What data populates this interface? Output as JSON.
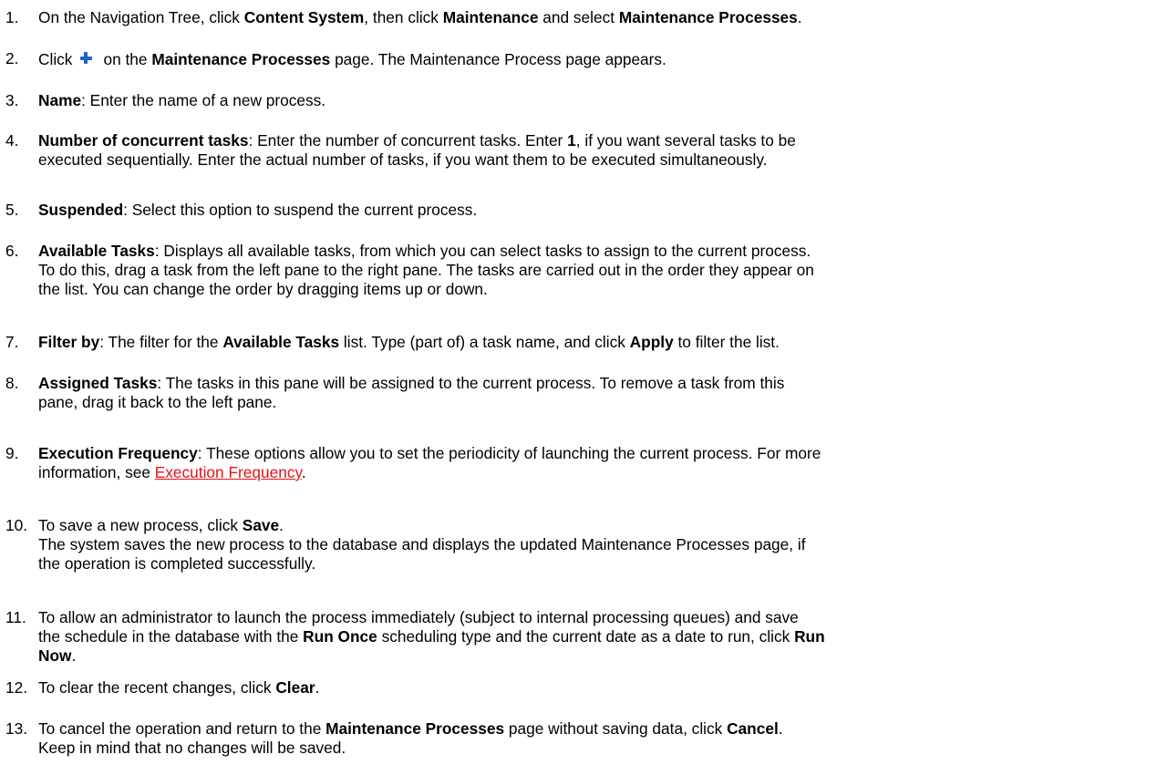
{
  "steps": [
    {
      "num": "1.",
      "parts": [
        {
          "t": "On the Navigation Tree, click "
        },
        {
          "t": "Content System",
          "b": true
        },
        {
          "t": ", then click "
        },
        {
          "t": "Maintenance",
          "b": true
        },
        {
          "t": " and select "
        },
        {
          "t": "Maintenance Processes",
          "b": true
        },
        {
          "t": "."
        }
      ]
    },
    {
      "num": "2.",
      "parts": [
        {
          "t": "Click"
        },
        {
          "icon": "plus-icon"
        },
        {
          "t": "on the "
        },
        {
          "t": "Maintenance Processes",
          "b": true
        },
        {
          "t": " page. The Maintenance Process page appears."
        }
      ]
    },
    {
      "num": "3.",
      "parts": [
        {
          "t": "Name",
          "b": true
        },
        {
          "t": ": Enter the name of a new process."
        }
      ]
    },
    {
      "num": "4.",
      "parts": [
        {
          "t": "Number of concurrent tasks",
          "b": true
        },
        {
          "t": ": Enter the number of concurrent tasks. Enter "
        },
        {
          "t": "1",
          "b": true
        },
        {
          "t": ", if you want several tasks to be"
        },
        {
          "br": true
        },
        {
          "t": "executed sequentially. Enter the actual number of tasks, if you want them to be executed simultaneously."
        }
      ]
    },
    {
      "num": "5.",
      "parts": [
        {
          "t": "Suspended",
          "b": true
        },
        {
          "t": ": Select this option to suspend the current process."
        }
      ]
    },
    {
      "num": "6.",
      "parts": [
        {
          "t": "Available Tasks",
          "b": true
        },
        {
          "t": ": Displays all available tasks, from which you can select tasks to assign to the current process."
        },
        {
          "br": true
        },
        {
          "t": "To do this, drag a task from the left pane to the right pane. The tasks are carried out in the order they appear on"
        },
        {
          "br": true
        },
        {
          "t": "the list. You can change the order by dragging items up or down."
        }
      ]
    },
    {
      "num": "7.",
      "parts": [
        {
          "t": "Filter by",
          "b": true
        },
        {
          "t": ": The filter for the "
        },
        {
          "t": "Available Tasks",
          "b": true
        },
        {
          "t": " list. Type (part of) a task name, and click "
        },
        {
          "t": "Apply",
          "b": true
        },
        {
          "t": " to filter the list."
        }
      ]
    },
    {
      "num": "8.",
      "parts": [
        {
          "t": "Assigned Tasks",
          "b": true
        },
        {
          "t": ": The tasks in this pane will be assigned to the current process. To remove a task from this"
        },
        {
          "br": true
        },
        {
          "t": "pane, drag it back to the left pane."
        }
      ]
    },
    {
      "num": "9.",
      "parts": [
        {
          "t": "Execution Frequency",
          "b": true
        },
        {
          "t": ": These options allow you to set the periodicity of launching the current process. For more"
        },
        {
          "br": true
        },
        {
          "t": "information, see "
        },
        {
          "t": "Execution Frequency",
          "link": true
        },
        {
          "t": "."
        }
      ]
    },
    {
      "num": "10.",
      "parts": [
        {
          "t": "To save a new process, click "
        },
        {
          "t": "Save",
          "b": true
        },
        {
          "t": "."
        },
        {
          "br": true
        },
        {
          "t": "The system saves the new process to the database and displays the updated Maintenance Processes page, if"
        },
        {
          "br": true
        },
        {
          "t": "the operation is completed successfully."
        }
      ]
    },
    {
      "num": "11.",
      "parts": [
        {
          "t": "To allow an administrator to launch the process immediately (subject to internal processing queues) and save"
        },
        {
          "br": true
        },
        {
          "t": "the schedule in the database with the "
        },
        {
          "t": "Run Once",
          "b": true
        },
        {
          "t": " scheduling type and the current date as a date to run, click "
        },
        {
          "t": "Run",
          "b": true
        },
        {
          "br": true
        },
        {
          "t": "Now",
          "b": true
        },
        {
          "t": "."
        }
      ]
    },
    {
      "num": "12.",
      "parts": [
        {
          "t": "To clear the recent changes, click "
        },
        {
          "t": "Clear",
          "b": true
        },
        {
          "t": "."
        }
      ]
    },
    {
      "num": "13.",
      "parts": [
        {
          "t": "To cancel the operation and return  to the "
        },
        {
          "t": "Maintenance Processes",
          "b": true
        },
        {
          "t": " page without saving data, click "
        },
        {
          "t": "Cancel",
          "b": true
        },
        {
          "t": "."
        },
        {
          "br": true
        },
        {
          "t": "Keep in mind that no changes will be saved."
        }
      ]
    }
  ]
}
